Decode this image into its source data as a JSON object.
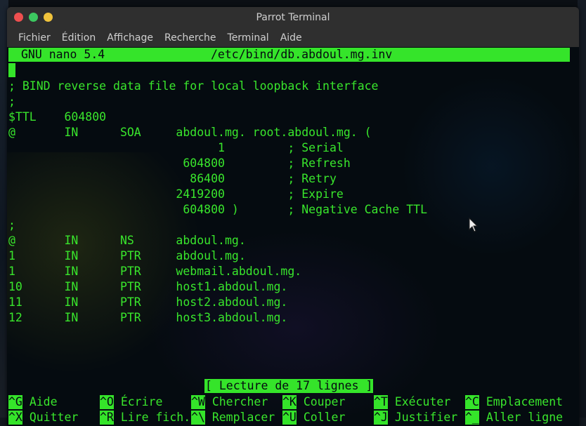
{
  "window": {
    "title": "Parrot Terminal"
  },
  "menubar": {
    "items": [
      "Fichier",
      "Édition",
      "Affichage",
      "Recherche",
      "Terminal",
      "Aide"
    ]
  },
  "nano": {
    "header_left": "GNU nano 5.4",
    "header_file": "/etc/bind/db.abdoul.mg.inv",
    "lines": [
      ";",
      "; BIND reverse data file for local loopback interface",
      ";",
      "$TTL    604800",
      "@       IN      SOA     abdoul.mg. root.abdoul.mg. (",
      "                              1         ; Serial",
      "                         604800         ; Refresh",
      "                          86400         ; Retry",
      "                        2419200         ; Expire",
      "                         604800 )       ; Negative Cache TTL",
      ";",
      "@       IN      NS      abdoul.mg.",
      "1       IN      PTR     abdoul.mg.",
      "1       IN      PTR     webmail.abdoul.mg.",
      "10      IN      PTR     host1.abdoul.mg.",
      "11      IN      PTR     host2.abdoul.mg.",
      "12      IN      PTR     host3.abdoul.mg."
    ],
    "status": "[ Lecture de 17 lignes ]",
    "shortcuts_row1": [
      {
        "key": "^G",
        "label": "Aide"
      },
      {
        "key": "^O",
        "label": "Écrire"
      },
      {
        "key": "^W",
        "label": "Chercher"
      },
      {
        "key": "^K",
        "label": "Couper"
      },
      {
        "key": "^T",
        "label": "Exécuter"
      },
      {
        "key": "^C",
        "label": "Emplacement"
      }
    ],
    "shortcuts_row2": [
      {
        "key": "^X",
        "label": "Quitter"
      },
      {
        "key": "^R",
        "label": "Lire fich."
      },
      {
        "key": "^\\",
        "label": "Remplacer"
      },
      {
        "key": "^U",
        "label": "Coller"
      },
      {
        "key": "^J",
        "label": "Justifier"
      },
      {
        "key": "^_",
        "label": "Aller ligne"
      }
    ]
  },
  "colors": {
    "terminal_green": "#39e62c",
    "terminal_bg": "#050b10",
    "titlebar": "#2f2f2f"
  }
}
